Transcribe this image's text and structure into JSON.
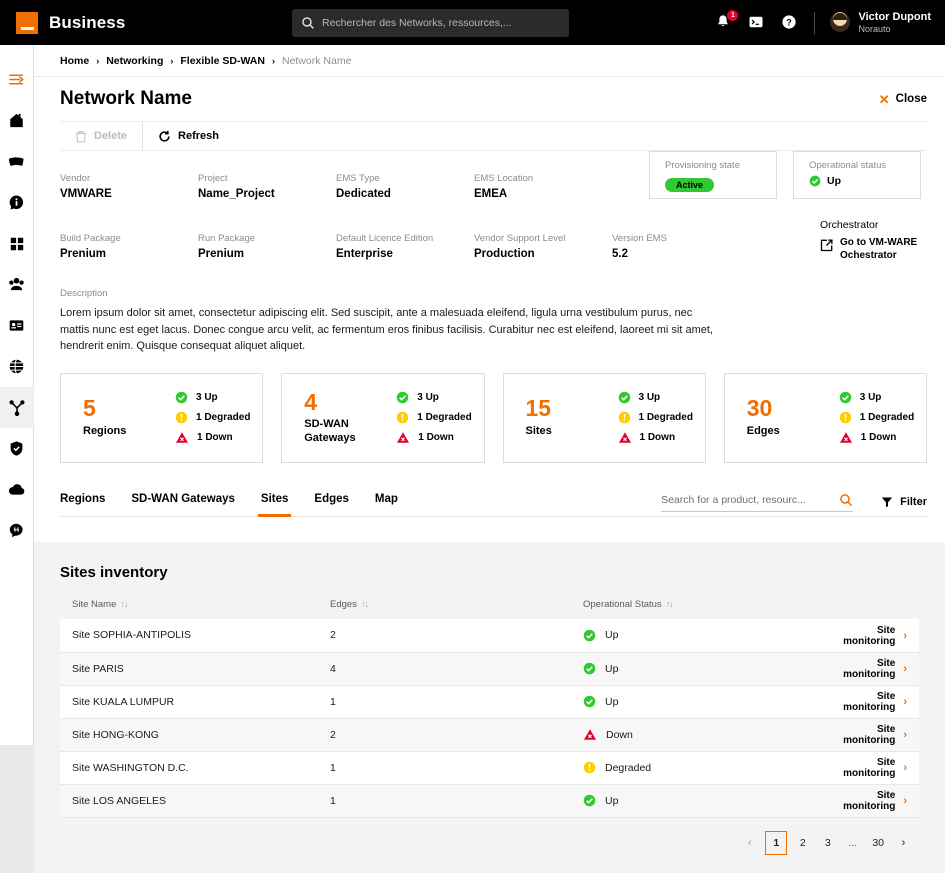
{
  "header": {
    "logo_label": "Business",
    "search_placeholder": "Rechercher des Networks, ressources,...",
    "search_value": "",
    "notification_count": "1",
    "user_name": "Victor Dupont",
    "user_org": "Norauto",
    "icons": [
      "bell-icon",
      "terminal-icon",
      "help-icon"
    ]
  },
  "sidebar": {
    "items": [
      {
        "name": "menu-toggle",
        "icon": "hamburger-arrow-icon",
        "active": false
      },
      {
        "name": "home",
        "icon": "home-icon",
        "active": false
      },
      {
        "name": "offers",
        "icon": "cards-icon",
        "active": false
      },
      {
        "name": "information",
        "icon": "info-icon",
        "active": false
      },
      {
        "name": "apps",
        "icon": "grid-icon",
        "active": false
      },
      {
        "name": "teams",
        "icon": "people-icon",
        "active": false
      },
      {
        "name": "contracts",
        "icon": "id-card-icon",
        "active": false
      },
      {
        "name": "global",
        "icon": "globe-icon",
        "active": false
      },
      {
        "name": "networking",
        "icon": "network-nodes-icon",
        "active": true
      },
      {
        "name": "security",
        "icon": "shield-icon",
        "active": false
      },
      {
        "name": "cloud",
        "icon": "cloud-icon",
        "active": false
      },
      {
        "name": "support-chat",
        "icon": "chat-icon",
        "active": false
      }
    ]
  },
  "breadcrumb": {
    "items": [
      "Home",
      "Networking",
      "Flexible SD-WAN"
    ],
    "current": "Network Name",
    "separator": "›"
  },
  "page": {
    "title": "Network Name",
    "close_label": "Close",
    "close_icon": "close-x-icon"
  },
  "toolbar": {
    "delete_label": "Delete",
    "refresh_label": "Refresh"
  },
  "details": {
    "row1": [
      {
        "label": "Vendor",
        "value": "VMWARE"
      },
      {
        "label": "Project",
        "value": "Name_Project"
      },
      {
        "label": "EMS Type",
        "value": "Dedicated"
      },
      {
        "label": "EMS Location",
        "value": "EMEA"
      }
    ],
    "row2": [
      {
        "label": "Build Package",
        "value": "Prenium"
      },
      {
        "label": "Run Package",
        "value": "Prenium"
      },
      {
        "label": "Default Licence Edition",
        "value": "Enterprise"
      },
      {
        "label": "Vendor Support Level",
        "value": "Production"
      },
      {
        "label": "Version EMS",
        "value": "5.2"
      }
    ],
    "provisioning": {
      "label": "Provisioning state",
      "value": "Active",
      "color": "#32c832"
    },
    "operational": {
      "label": "Operational status",
      "value": "Up",
      "color": "#32c832"
    },
    "orchestrator": {
      "label": "Orchestrator",
      "link_line1": "Go to VM-WARE",
      "link_line2": "Ochestrator",
      "icon": "external-link-icon"
    },
    "description": {
      "label": "Description",
      "text": "Lorem ipsum dolor sit amet, consectetur adipiscing elit. Sed suscipit, ante a malesuada eleifend, ligula urna vestibulum purus, nec mattis nunc est eget lacus. Donec congue arcu velit, ac fermentum eros finibus facilisis. Curabitur nec est eleifend, laoreet mi sit amet, hendrerit enim. Quisque consequat aliquet aliquet."
    }
  },
  "stat_cards": [
    {
      "count": "5",
      "label": "Regions",
      "up": "3 Up",
      "degraded": "1 Degraded",
      "down": "1 Down"
    },
    {
      "count": "4",
      "label": "SD-WAN\nGateways",
      "up": "3 Up",
      "degraded": "1 Degraded",
      "down": "1 Down"
    },
    {
      "count": "15",
      "label": "Sites",
      "up": "3 Up",
      "degraded": "1 Degraded",
      "down": "1 Down"
    },
    {
      "count": "30",
      "label": "Edges",
      "up": "3 Up",
      "degraded": "1 Degraded",
      "down": "1 Down"
    }
  ],
  "tabs": [
    {
      "label": "Regions",
      "active": false
    },
    {
      "label": "SD-WAN Gateways",
      "active": false
    },
    {
      "label": "Sites",
      "active": true
    },
    {
      "label": "Edges",
      "active": false
    },
    {
      "label": "Map",
      "active": false
    }
  ],
  "tab_tools": {
    "search_placeholder": "Search for a product, resourc...",
    "search_value": "",
    "search_icon": "search-icon",
    "filter_label": "Filter",
    "filter_icon": "funnel-icon"
  },
  "table": {
    "title": "Sites inventory",
    "columns": [
      "Site Name",
      "Edges",
      "Operational Status"
    ],
    "sort_glyph": "↑↓",
    "link_label": "Site monitoring",
    "rows": [
      {
        "site": "Site SOPHIA-ANTIPOLIS",
        "edges": "2",
        "status": "Up",
        "status_type": "up"
      },
      {
        "site": "Site PARIS",
        "edges": "4",
        "status": "Up",
        "status_type": "up"
      },
      {
        "site": "Site KUALA LUMPUR",
        "edges": "1",
        "status": "Up",
        "status_type": "up"
      },
      {
        "site": "Site HONG-KONG",
        "edges": "2",
        "status": "Down",
        "status_type": "down"
      },
      {
        "site": "Site WASHINGTON D.C.",
        "edges": "1",
        "status": "Degraded",
        "status_type": "degraded"
      },
      {
        "site": "Site LOS ANGELES",
        "edges": "1",
        "status": "Up",
        "status_type": "up"
      }
    ]
  },
  "pagination": {
    "prev": "‹",
    "next": "›",
    "pages": [
      "1",
      "2",
      "3",
      "...",
      "30"
    ],
    "current": "1"
  },
  "colors": {
    "brand_orange": "#f16e00",
    "status_up": "#32c832",
    "status_degraded": "#ffcc00",
    "status_down": "#e4002b",
    "black": "#000000"
  }
}
